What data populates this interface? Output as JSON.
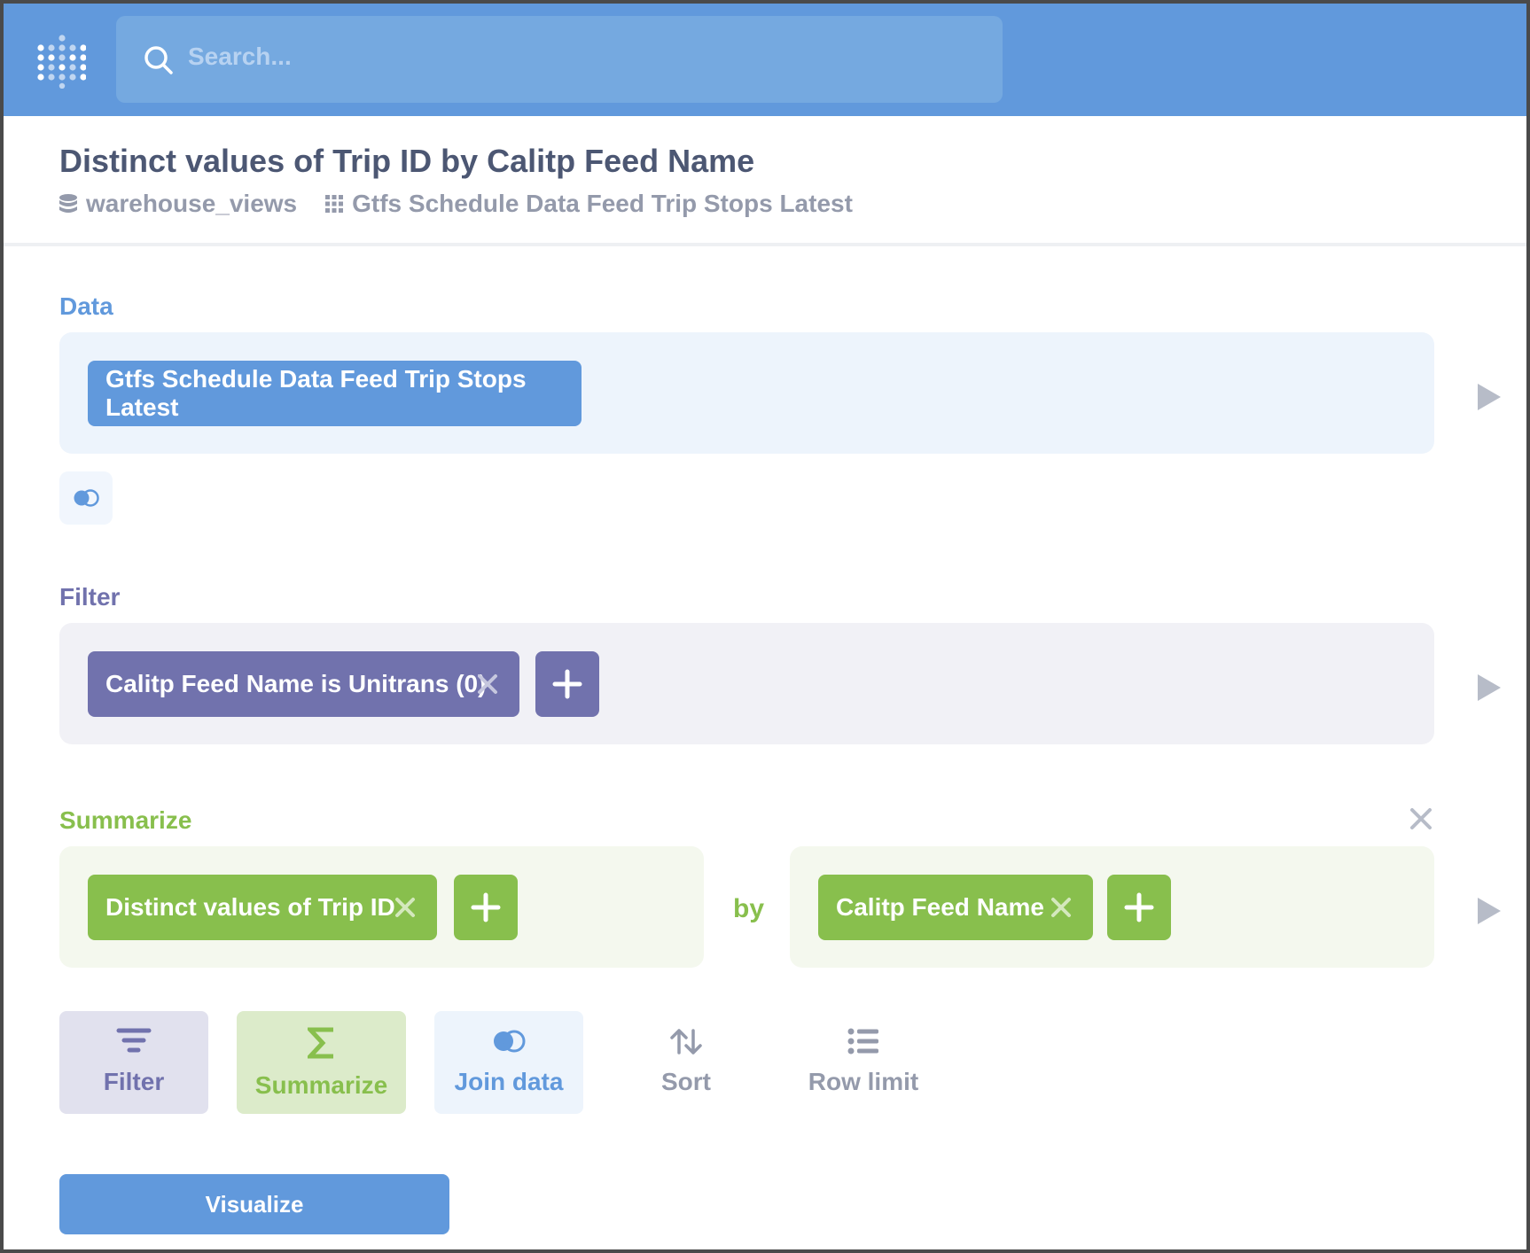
{
  "search": {
    "placeholder": "Search..."
  },
  "header": {
    "title": "Distinct values of Trip ID by Calitp Feed Name",
    "database": "warehouse_views",
    "table": "Gtfs Schedule Data Feed Trip Stops Latest"
  },
  "data_section": {
    "label": "Data",
    "source": "Gtfs Schedule Data Feed Trip Stops Latest"
  },
  "filter_section": {
    "label": "Filter",
    "filters": [
      "Calitp Feed Name is Unitrans (0)"
    ]
  },
  "summarize_section": {
    "label": "Summarize",
    "metrics": [
      "Distinct values of Trip ID"
    ],
    "by_label": "by",
    "breakouts": [
      "Calitp Feed Name"
    ]
  },
  "actions": {
    "filter": "Filter",
    "summarize": "Summarize",
    "join": "Join data",
    "sort": "Sort",
    "row_limit": "Row limit"
  },
  "visualize_label": "Visualize",
  "colors": {
    "brand": "#6199dc",
    "filter": "#7172ad",
    "summarize": "#88bf4d",
    "muted": "#949aab"
  }
}
